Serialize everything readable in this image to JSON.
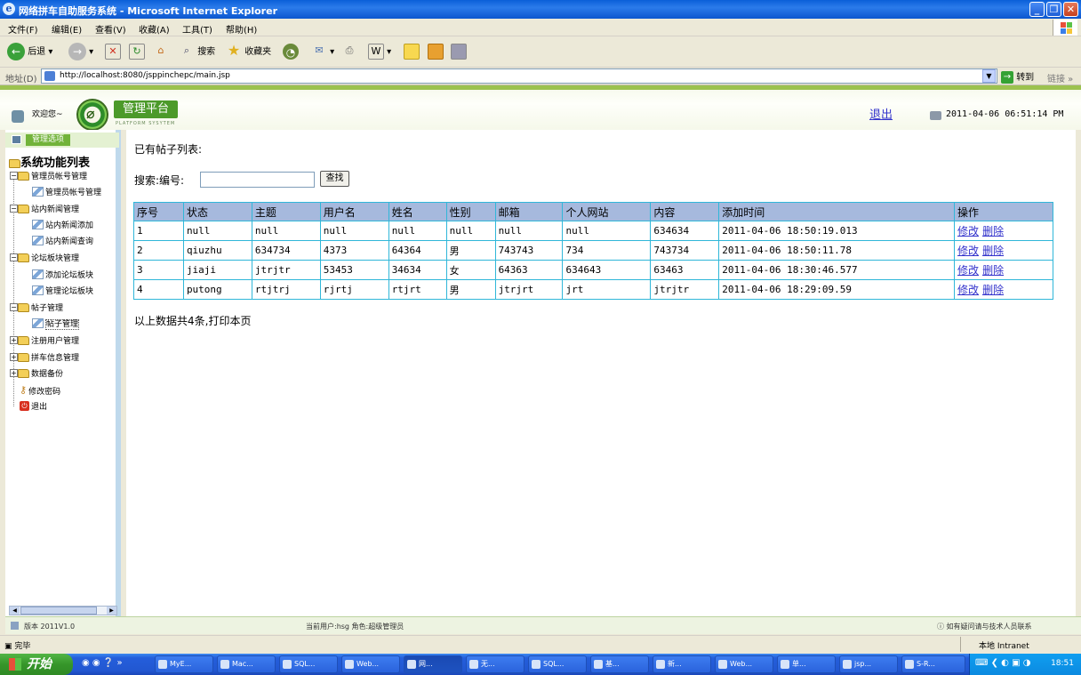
{
  "window": {
    "title": "网络拼车自助服务系统 - Microsoft Internet Explorer"
  },
  "menu": [
    "文件(F)",
    "编辑(E)",
    "查看(V)",
    "收藏(A)",
    "工具(T)",
    "帮助(H)"
  ],
  "toolbar": {
    "back": "后退",
    "search": "搜索",
    "favorites": "收藏夹"
  },
  "address": {
    "label": "地址(D)",
    "url": "http://localhost:8080/jsppinchepc/main.jsp",
    "go": "转到",
    "links": "链接"
  },
  "header": {
    "welcome": "欢迎您~",
    "logo_text": "管理平台",
    "logo_sub": "PLATFORM SYSYTEM",
    "logout": "退出",
    "datetime": "2011-04-06 06:51:14 PM"
  },
  "sidebar": {
    "head_label": "管理选项",
    "title": "系统功能列表",
    "nodes": [
      {
        "label": "管理员帐号管理",
        "children": [
          "管理员帐号管理"
        ]
      },
      {
        "label": "站内新闻管理",
        "children": [
          "站内新闻添加",
          "站内新闻查询"
        ]
      },
      {
        "label": "论坛板块管理",
        "children": [
          "添加论坛板块",
          "管理论坛板块"
        ]
      },
      {
        "label": "帖子管理",
        "children": [
          "帖子管理"
        ]
      },
      {
        "label": "注册用户管理",
        "children": []
      },
      {
        "label": "拼车信息管理",
        "children": []
      },
      {
        "label": "数据备份",
        "children": []
      }
    ],
    "change_password": "修改密码",
    "exit": "退出"
  },
  "main": {
    "heading": "已有帖子列表:",
    "search_label": "搜索:编号:",
    "search_value": "",
    "search_button": "查找",
    "columns": [
      "序号",
      "状态",
      "主题",
      "用户名",
      "姓名",
      "性别",
      "邮箱",
      "个人网站",
      "内容",
      "添加时间",
      "操作"
    ],
    "rows": [
      [
        "1",
        "null",
        "null",
        "null",
        "null",
        "null",
        "null",
        "null",
        "634634",
        "2011-04-06 18:50:19.013"
      ],
      [
        "2",
        "qiuzhu",
        "634734",
        "4373",
        "64364",
        "男",
        "743743",
        "734",
        "743734",
        "2011-04-06 18:50:11.78"
      ],
      [
        "3",
        "jiaji",
        "jtrjtr",
        "53453",
        "34634",
        "女",
        "64363",
        "634643",
        "63463",
        "2011-04-06 18:30:46.577"
      ],
      [
        "4",
        "putong",
        "rtjtrj",
        "rjrtj",
        "rtjrt",
        "男",
        "jtrjrt",
        "jrt",
        "jtrjtr",
        "2011-04-06 18:29:09.59"
      ]
    ],
    "edit_label": "修改",
    "delete_label": "删除",
    "summary": "以上数据共4条,打印本页"
  },
  "footer": {
    "version": "版本 2011V1.0",
    "user": "当前用户:hsg  角色:超级管理员",
    "help": "如有疑问请与技术人员联系"
  },
  "status": {
    "done": "完毕",
    "zone": "本地 Intranet"
  },
  "taskbar": {
    "start": "开始",
    "tasks": [
      "MyE...",
      "Mac...",
      "SQL...",
      "Web...",
      "网...",
      "无...",
      "SQL...",
      "基...",
      "新...",
      "Web...",
      "单...",
      "jsp...",
      "S-R..."
    ],
    "time": "18:51"
  }
}
